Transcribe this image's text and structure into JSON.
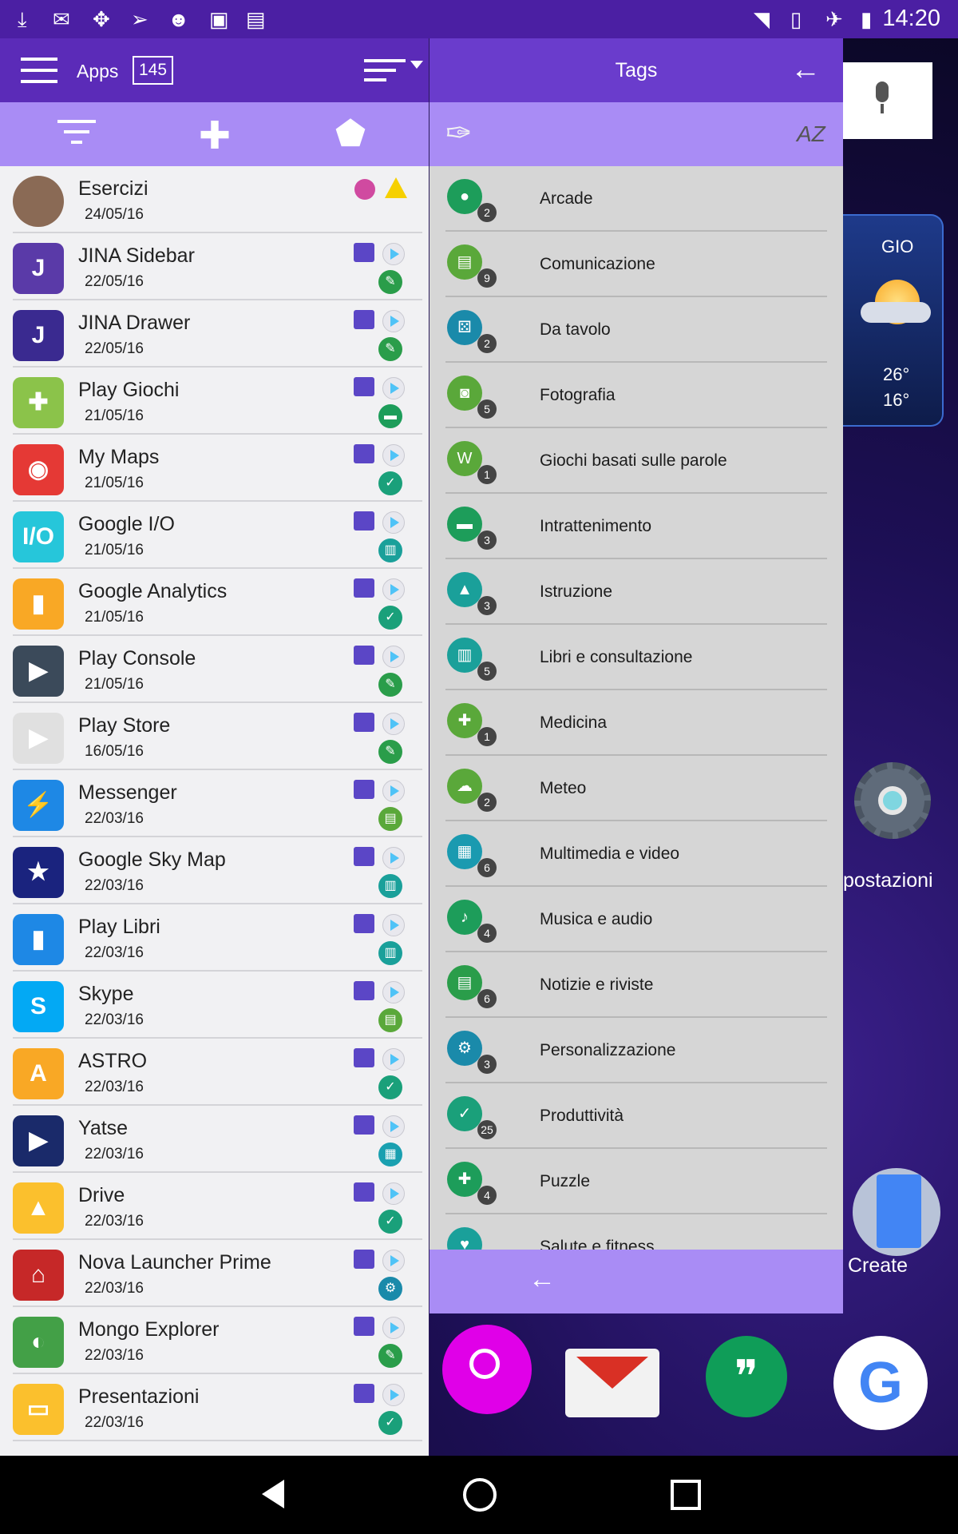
{
  "status_bar": {
    "time": "14:20",
    "left_icons": [
      "download-icon",
      "gmail-icon",
      "pinwheel-icon",
      "send-icon",
      "chat-icon",
      "android-icon",
      "shop-icon"
    ],
    "right_icons": [
      "wifi-icon",
      "no-sim-icon",
      "airplane-icon",
      "battery-icon"
    ]
  },
  "left_toolbar": {
    "title": "Apps",
    "count": "145"
  },
  "tags_header": {
    "title": "Tags"
  },
  "apps": [
    {
      "name": "Esercizi",
      "date": "24/05/16",
      "icon_color": "#8a6a55",
      "icon_text": "",
      "tag_color": "",
      "tag_glyph": "",
      "status": "warning"
    },
    {
      "name": "JINA Sidebar",
      "date": "22/05/16",
      "icon_color": "#5a3aa8",
      "icon_text": "J",
      "tag_color": "#2a9d4a",
      "tag_glyph": "✎"
    },
    {
      "name": "JINA Drawer",
      "date": "22/05/16",
      "icon_color": "#3a2a90",
      "icon_text": "J",
      "tag_color": "#2a9d4a",
      "tag_glyph": "✎"
    },
    {
      "name": "Play Giochi",
      "date": "21/05/16",
      "icon_color": "#8bc34a",
      "icon_text": "✚",
      "tag_color": "#1d9d5a",
      "tag_glyph": "▬"
    },
    {
      "name": "My Maps",
      "date": "21/05/16",
      "icon_color": "#e53935",
      "icon_text": "◉",
      "tag_color": "#1aa07a",
      "tag_glyph": "✓"
    },
    {
      "name": "Google I/O",
      "date": "21/05/16",
      "icon_color": "#26c6da",
      "icon_text": "I/O",
      "tag_color": "#1aa09a",
      "tag_glyph": "▥"
    },
    {
      "name": "Google Analytics",
      "date": "21/05/16",
      "icon_color": "#f9a825",
      "icon_text": "▮",
      "tag_color": "#1aa07a",
      "tag_glyph": "✓"
    },
    {
      "name": "Play Console",
      "date": "21/05/16",
      "icon_color": "#3b4a5a",
      "icon_text": "▶",
      "tag_color": "#2a9d4a",
      "tag_glyph": "✎"
    },
    {
      "name": "Play Store",
      "date": "16/05/16",
      "icon_color": "#e0e0e0",
      "icon_text": "▶",
      "tag_color": "#2a9d4a",
      "tag_glyph": "✎"
    },
    {
      "name": "Messenger",
      "date": "22/03/16",
      "icon_color": "#1e88e5",
      "icon_text": "⚡",
      "tag_color": "#5aa83a",
      "tag_glyph": "▤"
    },
    {
      "name": "Google Sky Map",
      "date": "22/03/16",
      "icon_color": "#1a237e",
      "icon_text": "★",
      "tag_color": "#1aa09a",
      "tag_glyph": "▥"
    },
    {
      "name": "Play Libri",
      "date": "22/03/16",
      "icon_color": "#1e88e5",
      "icon_text": "▮",
      "tag_color": "#1aa09a",
      "tag_glyph": "▥"
    },
    {
      "name": "Skype",
      "date": "22/03/16",
      "icon_color": "#03a9f4",
      "icon_text": "S",
      "tag_color": "#5aa83a",
      "tag_glyph": "▤"
    },
    {
      "name": "ASTRO",
      "date": "22/03/16",
      "icon_color": "#f9a825",
      "icon_text": "A",
      "tag_color": "#1aa07a",
      "tag_glyph": "✓"
    },
    {
      "name": "Yatse",
      "date": "22/03/16",
      "icon_color": "#1a2a6a",
      "icon_text": "▶",
      "tag_color": "#1aa0b0",
      "tag_glyph": "▦"
    },
    {
      "name": "Drive",
      "date": "22/03/16",
      "icon_color": "#fbc02d",
      "icon_text": "▲",
      "tag_color": "#1aa07a",
      "tag_glyph": "✓"
    },
    {
      "name": "Nova Launcher Prime",
      "date": "22/03/16",
      "icon_color": "#c62828",
      "icon_text": "⌂",
      "tag_color": "#1a8aaa",
      "tag_glyph": "⚙"
    },
    {
      "name": "Mongo Explorer",
      "date": "22/03/16",
      "icon_color": "#43a047",
      "icon_text": "◐",
      "tag_color": "#2a9d4a",
      "tag_glyph": "✎"
    },
    {
      "name": "Presentazioni",
      "date": "22/03/16",
      "icon_color": "#fbc02d",
      "icon_text": "▭",
      "tag_color": "#1aa07a",
      "tag_glyph": "✓"
    }
  ],
  "tags": [
    {
      "label": "Arcade",
      "count": "2",
      "color": "#1d9d5a",
      "glyph": "●"
    },
    {
      "label": "Comunicazione",
      "count": "9",
      "color": "#5aa83a",
      "glyph": "▤"
    },
    {
      "label": "Da tavolo",
      "count": "2",
      "color": "#1a8aaa",
      "glyph": "⚄"
    },
    {
      "label": "Fotografia",
      "count": "5",
      "color": "#5aa83a",
      "glyph": "◙"
    },
    {
      "label": "Giochi basati sulle parole",
      "count": "1",
      "color": "#5aa83a",
      "glyph": "W"
    },
    {
      "label": "Intrattenimento",
      "count": "3",
      "color": "#1d9d5a",
      "glyph": "▬"
    },
    {
      "label": "Istruzione",
      "count": "3",
      "color": "#1aa09a",
      "glyph": "▲"
    },
    {
      "label": "Libri e consultazione",
      "count": "5",
      "color": "#1aa09a",
      "glyph": "▥"
    },
    {
      "label": "Medicina",
      "count": "1",
      "color": "#5aa83a",
      "glyph": "✚"
    },
    {
      "label": "Meteo",
      "count": "2",
      "color": "#5aa83a",
      "glyph": "☁"
    },
    {
      "label": "Multimedia e video",
      "count": "6",
      "color": "#1a9ab0",
      "glyph": "▦"
    },
    {
      "label": "Musica e audio",
      "count": "4",
      "color": "#1d9d5a",
      "glyph": "♪"
    },
    {
      "label": "Notizie e riviste",
      "count": "6",
      "color": "#2a9d4a",
      "glyph": "▤"
    },
    {
      "label": "Personalizzazione",
      "count": "3",
      "color": "#1a8aaa",
      "glyph": "⚙"
    },
    {
      "label": "Produttività",
      "count": "25",
      "color": "#1aa07a",
      "glyph": "✓"
    },
    {
      "label": "Puzzle",
      "count": "4",
      "color": "#1d9d5a",
      "glyph": "✚"
    },
    {
      "label": "Salute e fitness",
      "count": "",
      "color": "#1aa09a",
      "glyph": "♥"
    }
  ],
  "home": {
    "weather_day": "GIO",
    "temp_high": "26°",
    "temp_low": "16°",
    "settings_label": "postazioni",
    "create_label": "Create"
  },
  "colors": {
    "toolbar_dark": "#5b2bb8",
    "toolbar_light": "#a98cf5",
    "list_bg": "#f1f1f3",
    "tags_bg": "#d6d6d6"
  }
}
